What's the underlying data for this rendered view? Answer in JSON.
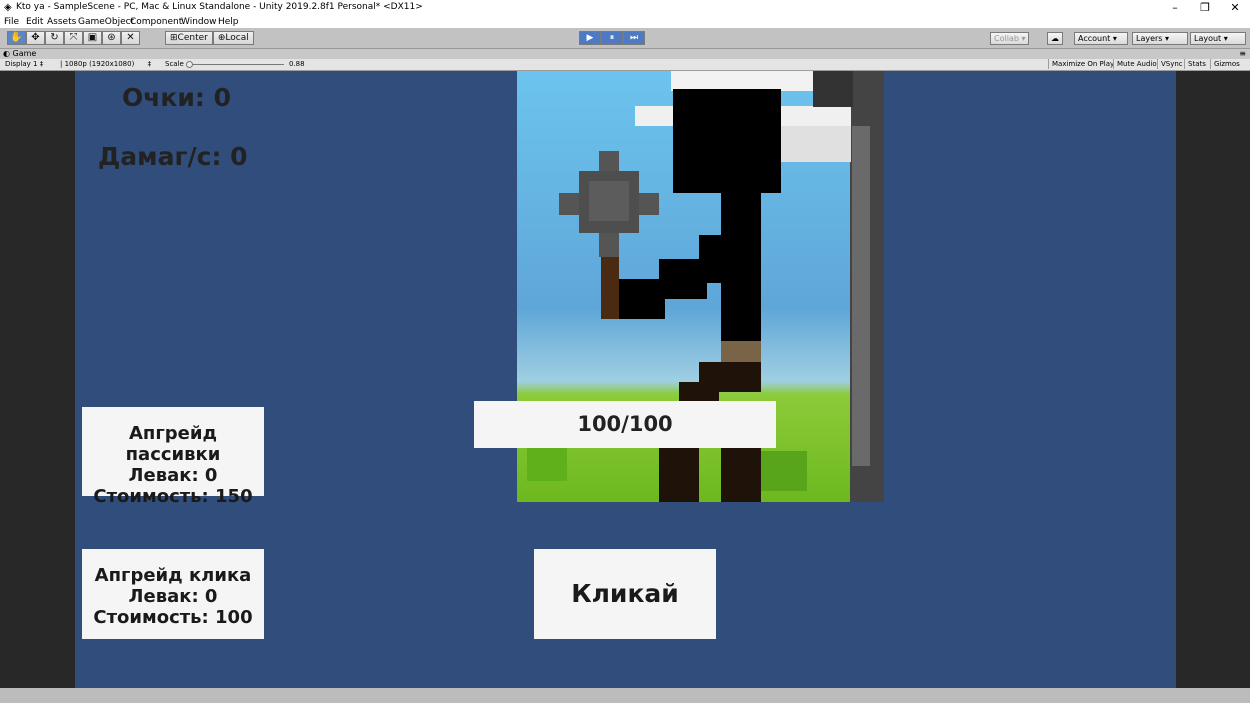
{
  "window": {
    "title": "Kto ya - SampleScene - PC, Mac & Linux Standalone - Unity 2019.2.8f1 Personal* <DX11>",
    "minimize": "–",
    "restore": "❐",
    "close": "✕"
  },
  "menu": [
    "File",
    "Edit",
    "Assets",
    "GameObject",
    "Component",
    "Window",
    "Help"
  ],
  "toolbar": {
    "tools": [
      "hand-icon",
      "move-icon",
      "rotate-icon",
      "scale-icon",
      "rect-icon",
      "transform-icon",
      "custom-tool-icon"
    ],
    "pivot_label": "⊞Center",
    "space_label": "⊕Local",
    "play_icon": "▶",
    "pause_icon": "⏸",
    "step_icon": "⏭",
    "collab_label": "Collab ▾",
    "cloud_icon": "☁",
    "account_label": "Account",
    "layers_label": "Layers",
    "layout_label": "Layout"
  },
  "game_tab": {
    "label": "Game",
    "display": "Display 1",
    "resolution": "1080p (1920x1080)",
    "scale_label": "Scale",
    "scale_value": "0.88",
    "maximize": "Maximize On Play",
    "mute": "Mute Audio",
    "vsync": "VSync",
    "stats": "Stats",
    "gizmos": "Gizmos"
  },
  "hud": {
    "score": "Очки: 0",
    "dps": "Дамаг/с: 0"
  },
  "enemy_hp": "100/100",
  "upgrade_passive": {
    "title": "Апгрейд пассивки",
    "level": "Левак: 0",
    "cost": "Стоимость: 150"
  },
  "upgrade_click": {
    "title": "Апгрейд клика",
    "level": "Левак: 0",
    "cost": "Стоимость: 100"
  },
  "click_button": "Кликай",
  "colors": {
    "canvas_bg": "#314d7b",
    "sky": "#5fb6e6",
    "grass": "#7fc22a",
    "panel": "#f5f5f5"
  }
}
